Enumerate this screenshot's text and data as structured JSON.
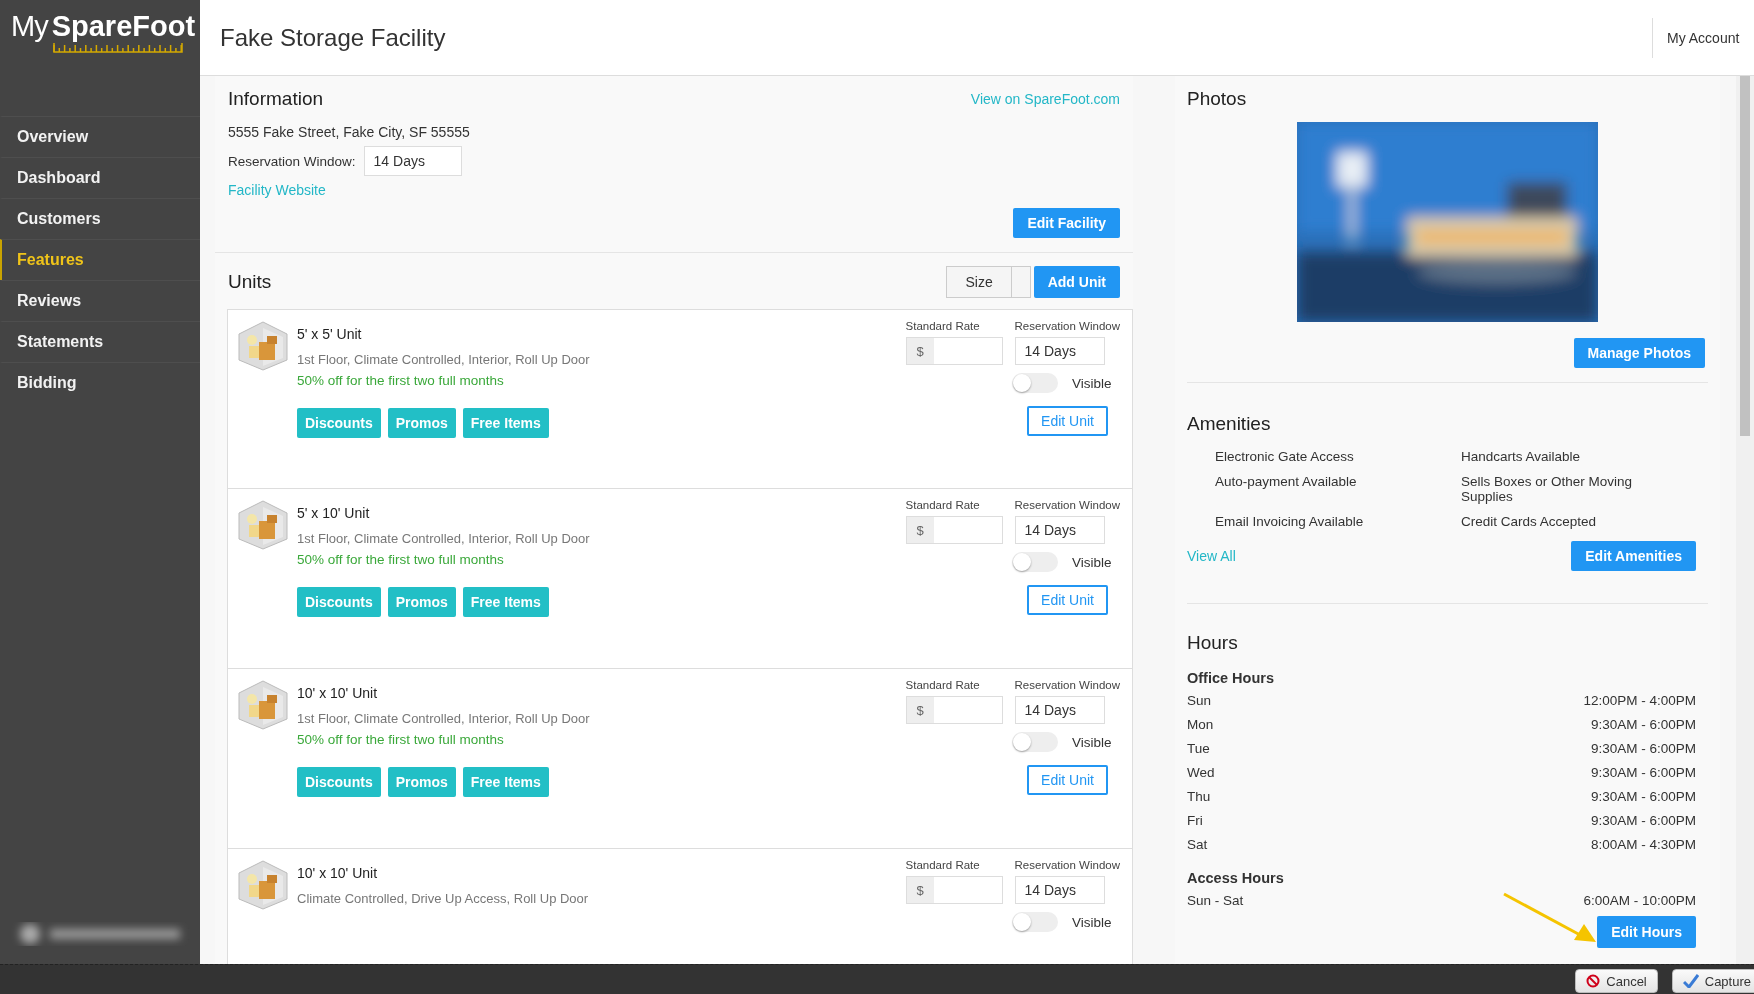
{
  "header": {
    "logo_my": "My",
    "logo_brand": "SpareFoot",
    "title": "Fake Storage Facility",
    "account": "My Account"
  },
  "sidebar": {
    "items": [
      {
        "label": "Overview",
        "selected": false
      },
      {
        "label": "Dashboard",
        "selected": false
      },
      {
        "label": "Customers",
        "selected": false
      },
      {
        "label": "Features",
        "selected": true
      },
      {
        "label": "Reviews",
        "selected": false
      },
      {
        "label": "Statements",
        "selected": false
      },
      {
        "label": "Bidding",
        "selected": false
      }
    ]
  },
  "information": {
    "title": "Information",
    "view_link": "View on SpareFoot.com",
    "address": "5555 Fake Street, Fake City, SF 55555",
    "reservation_label": "Reservation Window:",
    "reservation_value": "14 Days",
    "website_link": "Facility Website",
    "edit_button": "Edit Facility"
  },
  "units": {
    "title": "Units",
    "sort_button": "Size",
    "add_button": "Add Unit",
    "items": [
      {
        "name": "5' x 5' Unit",
        "features": "1st Floor, Climate Controlled, Interior, Roll Up Door",
        "promo": "50% off for the first two full months",
        "rate_label": "Standard Rate",
        "currency": "$",
        "window_label": "Reservation Window",
        "window_value": "14 Days",
        "visible_label": "Visible",
        "visible": false,
        "actions": [
          "Discounts",
          "Promos",
          "Free Items"
        ],
        "edit_button": "Edit Unit"
      },
      {
        "name": "5' x 10' Unit",
        "features": "1st Floor, Climate Controlled, Interior, Roll Up Door",
        "promo": "50% off for the first two full months",
        "rate_label": "Standard Rate",
        "currency": "$",
        "window_label": "Reservation Window",
        "window_value": "14 Days",
        "visible_label": "Visible",
        "visible": false,
        "actions": [
          "Discounts",
          "Promos",
          "Free Items"
        ],
        "edit_button": "Edit Unit"
      },
      {
        "name": "10' x 10' Unit",
        "features": "1st Floor, Climate Controlled, Interior, Roll Up Door",
        "promo": "50% off for the first two full months",
        "rate_label": "Standard Rate",
        "currency": "$",
        "window_label": "Reservation Window",
        "window_value": "14 Days",
        "visible_label": "Visible",
        "visible": false,
        "actions": [
          "Discounts",
          "Promos",
          "Free Items"
        ],
        "edit_button": "Edit Unit"
      },
      {
        "name": "10' x 10' Unit",
        "features": "Climate Controlled, Drive Up Access, Roll Up Door",
        "rate_label": "Standard Rate",
        "currency": "$",
        "window_label": "Reservation Window",
        "window_value": "14 Days",
        "visible_label": "Visible",
        "visible": false
      }
    ]
  },
  "photos": {
    "title": "Photos",
    "manage_button": "Manage Photos"
  },
  "amenities": {
    "title": "Amenities",
    "items": [
      "Electronic Gate Access",
      "Handcarts Available",
      "Auto-payment Available",
      "Sells Boxes or Other Moving Supplies",
      "Email Invoicing Available",
      "Credit Cards Accepted"
    ],
    "view_all": "View All",
    "edit_button": "Edit Amenities"
  },
  "hours": {
    "title": "Hours",
    "office_title": "Office Hours",
    "office": [
      {
        "day": "Sun",
        "time": "12:00PM - 4:00PM"
      },
      {
        "day": "Mon",
        "time": "9:30AM - 6:00PM"
      },
      {
        "day": "Tue",
        "time": "9:30AM - 6:00PM"
      },
      {
        "day": "Wed",
        "time": "9:30AM - 6:00PM"
      },
      {
        "day": "Thu",
        "time": "9:30AM - 6:00PM"
      },
      {
        "day": "Fri",
        "time": "9:30AM - 6:00PM"
      },
      {
        "day": "Sat",
        "time": "8:00AM - 4:30PM"
      }
    ],
    "access_title": "Access Hours",
    "access": [
      {
        "day": "Sun - Sat",
        "time": "6:00AM - 10:00PM"
      }
    ],
    "edit_button": "Edit Hours"
  },
  "capture_bar": {
    "cancel": "Cancel",
    "capture": "Capture"
  }
}
